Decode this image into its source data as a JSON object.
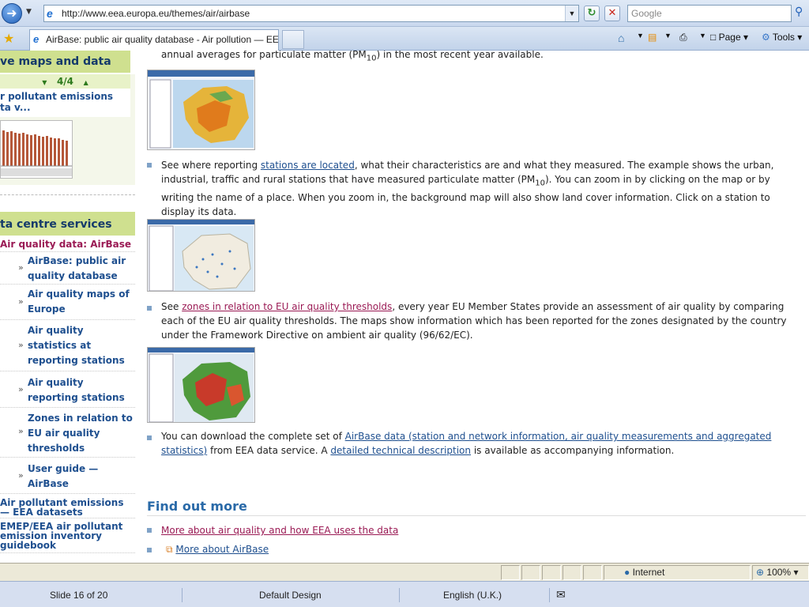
{
  "browser": {
    "url": "http://www.eea.europa.eu/themes/air/airbase",
    "search_placeholder": "Google",
    "tab_title": "AirBase: public air quality database - Air pollution — EEA",
    "commands": {
      "page": "Page",
      "tools": "Tools"
    }
  },
  "sidebar": {
    "maps_heading": "ve maps and data",
    "pager": "4/4",
    "widget_title": "r pollutant emissions ta v...",
    "services_heading": "ta centre services",
    "active_item": "Air quality data: AirBase",
    "items": [
      {
        "label": "AirBase: public air quality database"
      },
      {
        "label": "Air quality maps of Europe"
      },
      {
        "label": "Air quality statistics at reporting stations"
      },
      {
        "label": "Air quality reporting stations"
      },
      {
        "label": "Zones in relation to EU air quality thresholds"
      },
      {
        "label": "User guide — AirBase"
      }
    ],
    "extra_items": [
      {
        "label": "Air pollutant emissions — EEA datasets"
      },
      {
        "label": "EMEP/EEA air pollutant emission inventory guidebook"
      }
    ]
  },
  "main": {
    "top_line": "annual averages for particulate matter (PM",
    "top_line_sub": "10",
    "top_line_end": ") in the most recent year available.",
    "p1_a": "See where reporting ",
    "p1_link": "stations are located",
    "p1_b": ", what their characteristics are and what they measured. The example shows the urban, industrial, traffic and rural stations that have measured particulate matter (PM",
    "p1_sub": "10",
    "p1_c": "). You can zoom in by clicking on the map or by writing the name of a place. When you zoom in, the background map will also show land cover information. Click on a station to display its data.",
    "p2_a": "See ",
    "p2_link": "zones in relation to EU air quality thresholds",
    "p2_b": ", every year EU Member States provide an assessment of air quality by comparing each of the EU air quality thresholds. The maps show information which has been reported for the zones designated by the country under the Framework Directive on ambient air quality (96/62/EC).",
    "p3_a": "You can download the complete set of ",
    "p3_link1": "AirBase data (station and network information, air quality measurements and aggregated statistics)",
    "p3_b": " from EEA data service. A ",
    "p3_link2": "detailed technical description",
    "p3_c": " is available as accompanying information.",
    "find_out_more": "Find out more",
    "more_links": [
      "More about air quality and how EEA uses the data",
      "More about AirBase"
    ]
  },
  "statusbar": {
    "zone": "Internet",
    "zoom": "100%"
  },
  "ppt_status": {
    "slide": "Slide 16 of 20",
    "design": "Default Design",
    "language": "English (U.K.)"
  }
}
